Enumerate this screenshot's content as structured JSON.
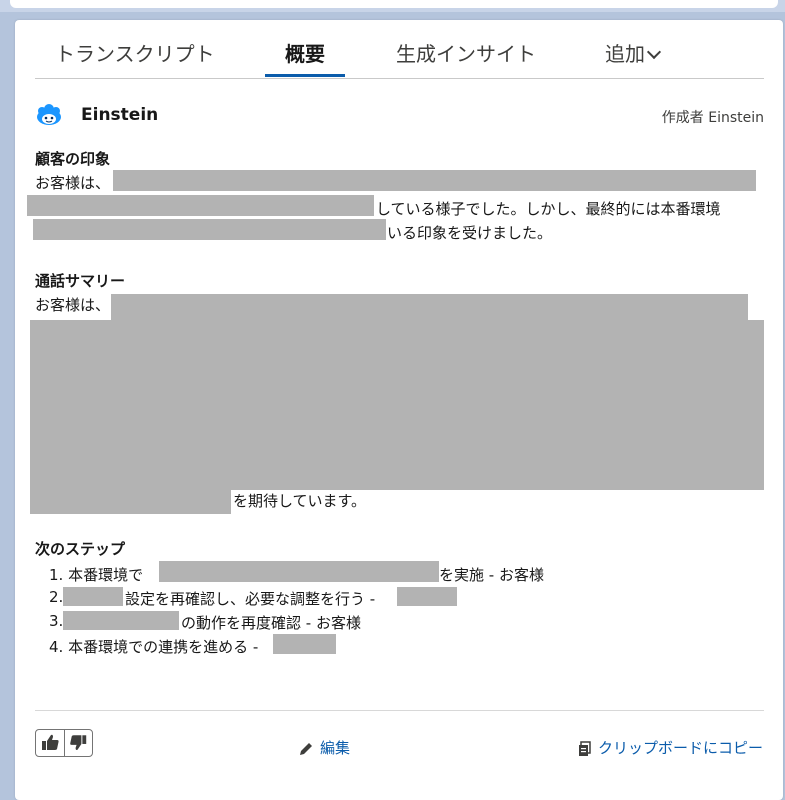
{
  "tabs": [
    {
      "label": "トランスクリプト"
    },
    {
      "label": "概要"
    },
    {
      "label": "生成インサイト"
    },
    {
      "label": "追加"
    }
  ],
  "header": {
    "name": "Einstein",
    "author": "作成者 Einstein"
  },
  "impression": {
    "title": "顧客の印象",
    "line1_start": "お客様は、",
    "line2_end": "している様子でした。しかし、最終的には本番環境",
    "line3_end": "いる印象を受けました。"
  },
  "summary": {
    "title": "通話サマリー",
    "line1_start": "お客様は、",
    "last_end": "を期待しています。"
  },
  "next_steps": {
    "title": "次のステップ",
    "items": [
      {
        "num": "1.",
        "start": "本番環境で",
        "end": "を実施 - お客様"
      },
      {
        "num": "2.",
        "start": "",
        "end": "設定を再確認し、必要な調整を行う -"
      },
      {
        "num": "3.",
        "start": "",
        "end": "の動作を再度確認 - お客様"
      },
      {
        "num": "4.",
        "start": "本番環境での連携を進める -",
        "end": ""
      }
    ]
  },
  "footer": {
    "edit_label": "編集",
    "copy_label": "クリップボードにコピー"
  },
  "colors": {
    "accent": "#0b5cab",
    "redaction": "#b3b3b3",
    "einstein": "#1b96ff"
  }
}
